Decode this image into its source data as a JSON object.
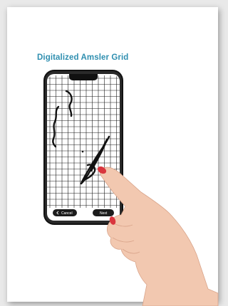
{
  "title": "Digitalized Amsler Grid",
  "buttons": {
    "cancel_label": "Cancel",
    "next_label": "Next"
  },
  "icons": {
    "cancel": "chevron-left-icon"
  },
  "colors": {
    "title": "#2f8fb0",
    "grid_line": "#1a1a1a",
    "button_bg": "#1c1c1c",
    "nail": "#d9363e"
  }
}
